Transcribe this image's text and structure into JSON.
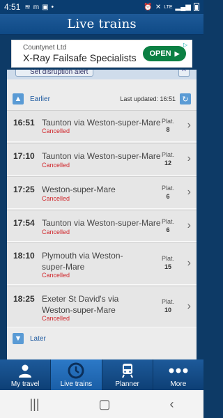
{
  "status_bar": {
    "time": "4:51",
    "lte": "LTE"
  },
  "app": {
    "title": "Live trains"
  },
  "ad": {
    "advertiser": "Countynet Ltd",
    "headline": "X-Ray Failsafe Specialists",
    "cta": "OPEN",
    "cta_color": "#0b8043"
  },
  "disruption": {
    "button_label": "Set disruption alert"
  },
  "panel": {
    "earlier_label": "Earlier",
    "later_label": "Later",
    "last_updated": "Last updated: 16:51"
  },
  "trains": [
    {
      "time": "16:51",
      "destination": "Taunton via Weston-super-Mare",
      "status": "Cancelled",
      "plat_label": "Plat.",
      "platform": "8"
    },
    {
      "time": "17:10",
      "destination": "Taunton via Weston-super-Mare",
      "status": "Cancelled",
      "plat_label": "Plat.",
      "platform": "12"
    },
    {
      "time": "17:25",
      "destination": "Weston-super-Mare",
      "status": "Cancelled",
      "plat_label": "Plat.",
      "platform": "6"
    },
    {
      "time": "17:54",
      "destination": "Taunton via Weston-super-Mare",
      "status": "Cancelled",
      "plat_label": "Plat.",
      "platform": "6"
    },
    {
      "time": "18:10",
      "destination": "Plymouth via Weston-super-Mare",
      "status": "Cancelled",
      "plat_label": "Plat.",
      "platform": "15"
    },
    {
      "time": "18:25",
      "destination": "Exeter St David's via Weston-super-Mare",
      "status": "Cancelled",
      "plat_label": "Plat.",
      "platform": "10"
    }
  ],
  "colors": {
    "cancelled": "#d0262b",
    "header": "#1e5a98"
  },
  "nav": {
    "items": [
      {
        "label": "My travel",
        "icon": "person-icon"
      },
      {
        "label": "Live trains",
        "icon": "clock-icon"
      },
      {
        "label": "Planner",
        "icon": "train-icon"
      },
      {
        "label": "More",
        "icon": "more-icon"
      }
    ]
  }
}
